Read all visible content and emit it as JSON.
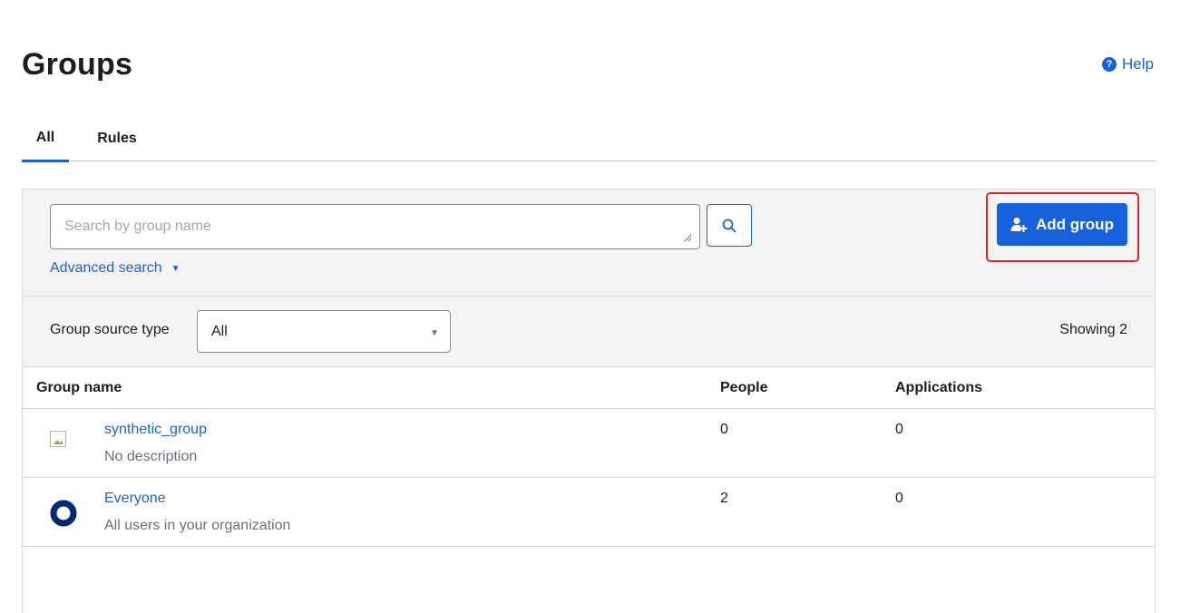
{
  "header": {
    "title": "Groups",
    "help_label": "Help"
  },
  "tabs": [
    {
      "label": "All",
      "active": true
    },
    {
      "label": "Rules",
      "active": false
    }
  ],
  "toolbar": {
    "search_placeholder": "Search by group name",
    "search_value": "",
    "advanced_search_label": "Advanced search",
    "add_group_label": "Add group"
  },
  "filter": {
    "label": "Group source type",
    "selected": "All",
    "showing": "Showing 2"
  },
  "table": {
    "columns": [
      "Group name",
      "People",
      "Applications"
    ],
    "rows": [
      {
        "name": "synthetic_group",
        "description": "No description",
        "people": "0",
        "applications": "0",
        "icon": "broken-image-icon"
      },
      {
        "name": "Everyone",
        "description": "All users in your organization",
        "people": "2",
        "applications": "0",
        "icon": "okta-ring-icon"
      }
    ]
  },
  "colors": {
    "accent": "#1662dd",
    "highlight": "#e0242d",
    "panel_bg": "#f4f4f4"
  }
}
